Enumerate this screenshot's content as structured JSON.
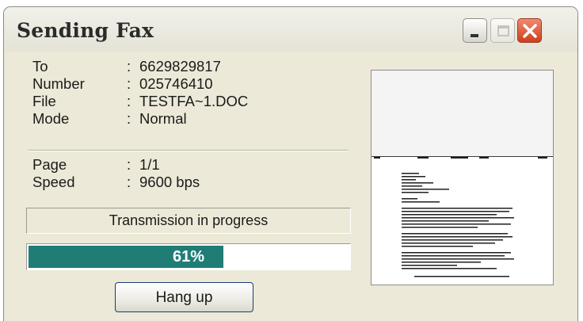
{
  "window": {
    "title": "Sending Fax",
    "controls": [
      {
        "name": "minimize",
        "icon": "minimize-icon"
      },
      {
        "name": "maximize",
        "icon": "maximize-icon"
      },
      {
        "name": "close",
        "icon": "close-icon"
      }
    ]
  },
  "info": {
    "to": {
      "label": "To",
      "sep": ":",
      "value": "6629829817"
    },
    "number": {
      "label": "Number",
      "sep": ":",
      "value": "025746410"
    },
    "file": {
      "label": "File",
      "sep": ":",
      "value": "TESTFA~1.DOC"
    },
    "mode": {
      "label": "Mode",
      "sep": ":",
      "value": "Normal"
    },
    "page": {
      "label": "Page",
      "sep": ":",
      "value": "1/1"
    },
    "speed": {
      "label": "Speed",
      "sep": ":",
      "value": "9600 bps"
    }
  },
  "status": {
    "text": "Transmission in progress"
  },
  "progress": {
    "percent": 61,
    "label": "61%",
    "fill_color": "#1f7d76"
  },
  "actions": {
    "hangup_label": "Hang up"
  },
  "preview": {
    "icon": "fax-page-thumbnail"
  }
}
